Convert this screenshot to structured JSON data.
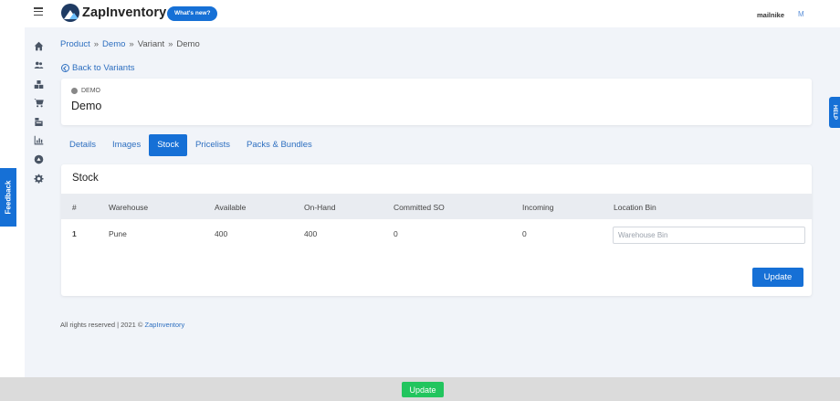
{
  "app": {
    "name": "ZapInventory",
    "whats_new": "What's new?"
  },
  "user": {
    "name": "mailnike",
    "avatar_initial": "M"
  },
  "nav": [
    "home-icon",
    "users-icon",
    "boxes-icon",
    "cart-icon",
    "inventory-icon",
    "chart-icon",
    "circle-icon",
    "gear-icon"
  ],
  "breadcrumb": {
    "product": "Product",
    "demo": "Demo",
    "variant": "Variant",
    "current": "Demo",
    "sep": "»"
  },
  "back_link": "Back to Variants",
  "variant": {
    "tag": "DEMO",
    "title": "Demo"
  },
  "tabs": [
    {
      "label": "Details",
      "active": false
    },
    {
      "label": "Images",
      "active": false
    },
    {
      "label": "Stock",
      "active": true
    },
    {
      "label": "Pricelists",
      "active": false
    },
    {
      "label": "Packs & Bundles",
      "active": false
    }
  ],
  "stock": {
    "title": "Stock",
    "columns": [
      "#",
      "Warehouse",
      "Available",
      "On-Hand",
      "Committed SO",
      "Incoming",
      "Location Bin"
    ],
    "rows": [
      {
        "index": "1",
        "warehouse": "Pune",
        "available": "400",
        "on_hand": "400",
        "committed_so": "0",
        "incoming": "0",
        "bin_placeholder": "Warehouse Bin",
        "bin_value": ""
      }
    ],
    "update_label": "Update"
  },
  "footer": {
    "text": "All rights reserved | 2021 ©",
    "link": "ZapInventory"
  },
  "feedback_label": "Feedback",
  "help_label": "HELP",
  "bottom_update_label": "Update",
  "colors": {
    "primary": "#1670d6",
    "success": "#22c55e",
    "link": "#2e6fc0"
  }
}
